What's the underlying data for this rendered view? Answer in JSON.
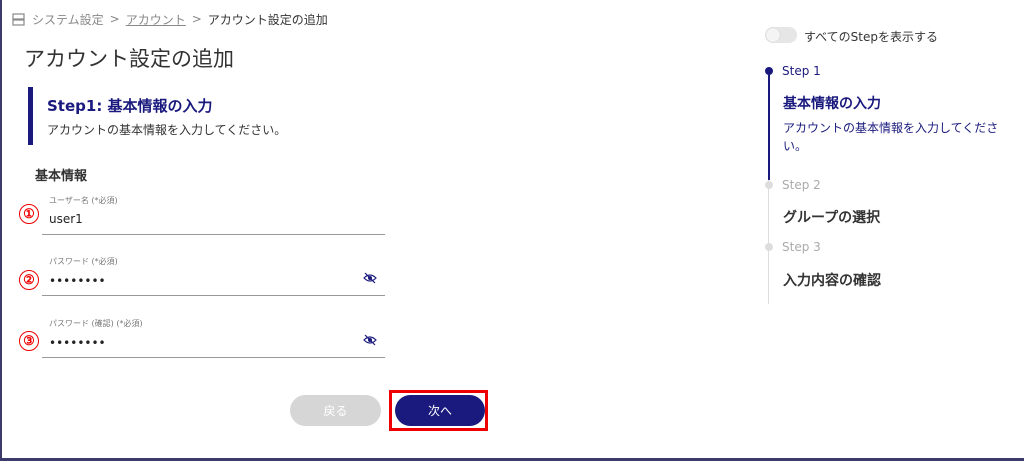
{
  "breadcrumb": {
    "root": "システム設定",
    "parent": "アカウント",
    "current": "アカウント設定の追加",
    "separator": ">"
  },
  "page_title": "アカウント設定の追加",
  "step_header": {
    "title": "Step1: 基本情報の入力",
    "description": "アカウントの基本情報を入力してください。"
  },
  "section_label": "基本情報",
  "markers": [
    "①",
    "②",
    "③"
  ],
  "fields": [
    {
      "label": "ユーザー名 (*必須)",
      "value": "user1"
    },
    {
      "label": "パスワード (*必須)",
      "value": "••••••••"
    },
    {
      "label": "パスワード (確認) (*必須)",
      "value": "••••••••"
    }
  ],
  "buttons": {
    "back": "戻る",
    "next": "次へ"
  },
  "toggle": {
    "label": "すべてのStepを表示する",
    "on": false
  },
  "stepper": [
    {
      "num": "Step 1",
      "title": "基本情報の入力",
      "desc": "アカウントの基本情報を入力してください。",
      "active": true
    },
    {
      "num": "Step 2",
      "title": "グループの選択",
      "active": false
    },
    {
      "num": "Step 3",
      "title": "入力内容の確認",
      "active": false
    }
  ],
  "icons": {
    "breadcrumb": "server-icon",
    "password_toggle": "eye-slash-icon"
  },
  "colors": {
    "primary": "#1a1a7e",
    "highlight": "#ee0000",
    "disabled_button": "#d6d6d6"
  }
}
